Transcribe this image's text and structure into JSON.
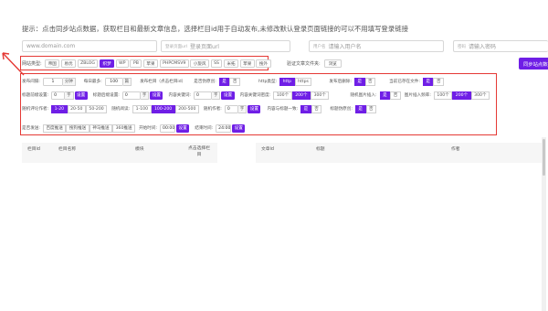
{
  "hint": "提示：点击同步站点数据，获取栏目和最新文章信息，选择栏目id用于自动发布,未修改默认登录页面链接的可以不用填写登录链接",
  "site_url": "www.domain.com",
  "login_label": "登录页面url",
  "login_placeholder": "登录页面url",
  "user_label": "用户名",
  "user_placeholder": "请输入用户名",
  "pass_label": "密码",
  "pass_placeholder": "请输入密码",
  "site_type_label": "网站类型:",
  "site_types": [
    "帝国",
    "易优",
    "ZBLOG",
    "织梦",
    "WP",
    "PB",
    "苹果",
    "PHPCMSV9",
    "小旋风",
    "SS",
    "米拓",
    "苹果",
    "搜外"
  ],
  "save_label": "验证文章文件夹:",
  "save_btn": "浏览",
  "sync_btn": "同步站点数据",
  "settings": {
    "interval_label": "发布间隔:",
    "interval_val": "1",
    "interval_unit": "分钟",
    "daily_label": "每日最多:",
    "daily_val": "100",
    "daily_unit": "篇",
    "publish_col_label": "发布栏目（点击栏目id）",
    "shuffle_label": "是否伪原创:",
    "yes": "是",
    "no": "否",
    "http_label": "http类型:",
    "http": "http",
    "https": "https",
    "delete_label": "发布后删除:",
    "trans_label": "当前已存在文件:",
    "kw_insert_label": "标题前缀设置:",
    "kw_zero": "0",
    "kw_unit": "字",
    "set": "设置",
    "title_suffix_label": "标题后缀设置:",
    "content_kw_label": "内容关键词:",
    "kw_density_label": "内容关键词密度:",
    "density_opts": [
      "100个",
      "200个",
      "300个"
    ],
    "img_insert_label": "随机图片插入:",
    "img_density_label": "图片插入频率:",
    "comment_label": "随机评论作者:",
    "comment_opts": [
      "1-20",
      "20-50",
      "50-200"
    ],
    "read_label": "随机阅读:",
    "read_opts": [
      "1-100",
      "100-200",
      "200-500"
    ],
    "author_label": "随机作者:",
    "match_label": "内容与标题一致:",
    "tag_label": "标题伪原创:",
    "sort_label": "是否发送:",
    "sort_opts": [
      "百度推送",
      "搜狗推送",
      "神马推送",
      "360推送"
    ],
    "start_label": "开始时间:",
    "start_val": "00:00",
    "end_label": "结束时间:",
    "end_val": "24:00"
  },
  "left_table": {
    "headers": [
      "栏目id",
      "栏目名称",
      "模块",
      "点击选择栏目"
    ]
  },
  "right_table": {
    "headers": [
      "文章id",
      "标题",
      "作者"
    ]
  }
}
